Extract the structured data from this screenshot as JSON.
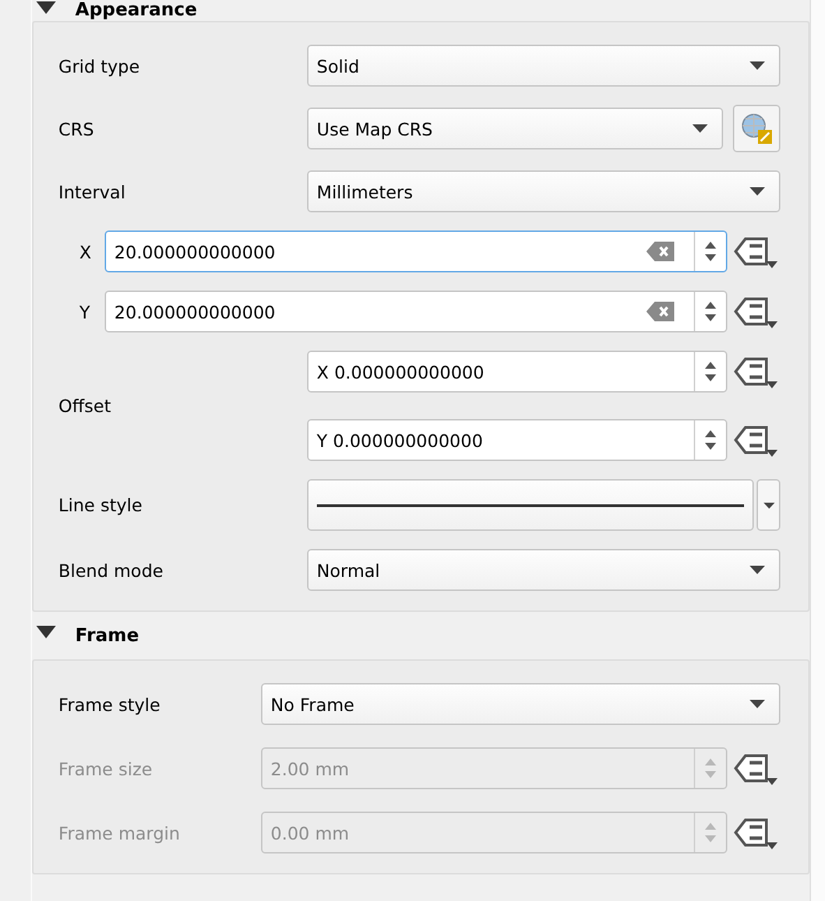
{
  "sections": [
    {
      "title": "Appearance",
      "expanded": true,
      "rows": [
        {
          "kind": "combo",
          "label": "Grid type",
          "value": "Solid"
        },
        {
          "kind": "crs",
          "label": "CRS",
          "value": "Use Map CRS"
        },
        {
          "kind": "combo",
          "label": "Interval",
          "value": "Millimeters"
        },
        {
          "kind": "axis",
          "label": "X",
          "value": "20.000000000000",
          "focused": true
        },
        {
          "kind": "axis",
          "label": "Y",
          "value": "20.000000000000",
          "focused": false
        },
        {
          "kind": "offset",
          "label": "Offset",
          "values": [
            "X 0.000000000000",
            "Y 0.000000000000"
          ]
        },
        {
          "kind": "line",
          "label": "Line style"
        },
        {
          "kind": "combo",
          "label": "Blend mode",
          "value": "Normal"
        }
      ]
    },
    {
      "title": "Frame",
      "expanded": true,
      "rows": [
        {
          "kind": "combo",
          "label": "Frame style",
          "value": "No Frame"
        },
        {
          "kind": "spin",
          "label": "Frame size",
          "value": "2.00 mm",
          "disabled": true
        },
        {
          "kind": "spin",
          "label": "Frame margin",
          "value": "0.00 mm",
          "disabled": true
        }
      ]
    }
  ]
}
